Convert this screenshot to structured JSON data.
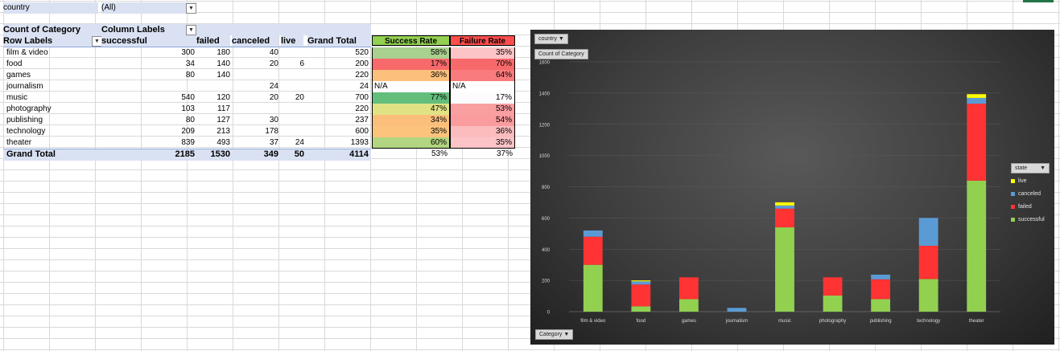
{
  "filter": {
    "label": "country",
    "value": "(All)"
  },
  "pivot": {
    "header1": {
      "measure": "Count of Category",
      "col_labels": "Column Labels"
    },
    "header2": {
      "row_labels": "Row Labels",
      "cols": [
        "successful",
        "failed",
        "canceled",
        "live",
        "Grand Total"
      ]
    },
    "rows": [
      {
        "label": "film & video",
        "successful": "300",
        "failed": "180",
        "canceled": "40",
        "live": "",
        "total": "520"
      },
      {
        "label": "food",
        "successful": "34",
        "failed": "140",
        "canceled": "20",
        "live": "6",
        "total": "200"
      },
      {
        "label": "games",
        "successful": "80",
        "failed": "140",
        "canceled": "",
        "live": "",
        "total": "220"
      },
      {
        "label": "journalism",
        "successful": "",
        "failed": "",
        "canceled": "24",
        "live": "",
        "total": "24"
      },
      {
        "label": "music",
        "successful": "540",
        "failed": "120",
        "canceled": "20",
        "live": "20",
        "total": "700"
      },
      {
        "label": "photography",
        "successful": "103",
        "failed": "117",
        "canceled": "",
        "live": "",
        "total": "220"
      },
      {
        "label": "publishing",
        "successful": "80",
        "failed": "127",
        "canceled": "30",
        "live": "",
        "total": "237"
      },
      {
        "label": "technology",
        "successful": "209",
        "failed": "213",
        "canceled": "178",
        "live": "",
        "total": "600"
      },
      {
        "label": "theater",
        "successful": "839",
        "failed": "493",
        "canceled": "37",
        "live": "24",
        "total": "1393"
      }
    ],
    "grand_total": {
      "label": "Grand Total",
      "successful": "2185",
      "failed": "1530",
      "canceled": "349",
      "live": "50",
      "total": "4114"
    }
  },
  "rates": {
    "success_header": "Success Rate",
    "failure_header": "Failure Rate",
    "success": [
      "58%",
      "17%",
      "36%",
      "N/A",
      "77%",
      "47%",
      "34%",
      "35%",
      "60%"
    ],
    "failure": [
      "35%",
      "70%",
      "64%",
      "N/A",
      "17%",
      "53%",
      "54%",
      "36%",
      "35%"
    ],
    "success_colors": [
      "#a9d08e",
      "#f8696b",
      "#fdc07c",
      "#ffffff",
      "#63be7b",
      "#e0e383",
      "#fcbf7b",
      "#fcc37c",
      "#b1d580"
    ],
    "failure_colors": [
      "#fcc4c7",
      "#f8696b",
      "#f97b7d",
      "#ffffff",
      "#fcfcff",
      "#fa9fa1",
      "#fa9b9d",
      "#fbbcbe",
      "#fcc4c7"
    ],
    "totals": {
      "success": "53%",
      "failure": "37%"
    }
  },
  "chart": {
    "filter_button": "country",
    "value_button": "Count of Category",
    "axis_button": "Category",
    "legend_title": "state",
    "colors": {
      "successful": "#92d050",
      "failed": "#ff3333",
      "canceled": "#5b9bd5",
      "live": "#ffff00"
    }
  },
  "chart_data": {
    "type": "bar",
    "stacked": true,
    "categories": [
      "film & video",
      "food",
      "games",
      "journalism",
      "music",
      "photography",
      "publishing",
      "technology",
      "theater"
    ],
    "series": [
      {
        "name": "successful",
        "values": [
          300,
          34,
          80,
          0,
          540,
          103,
          80,
          209,
          839
        ]
      },
      {
        "name": "failed",
        "values": [
          180,
          140,
          140,
          0,
          120,
          117,
          127,
          213,
          493
        ]
      },
      {
        "name": "canceled",
        "values": [
          40,
          20,
          0,
          24,
          20,
          0,
          30,
          178,
          37
        ]
      },
      {
        "name": "live",
        "values": [
          0,
          6,
          0,
          0,
          20,
          0,
          0,
          0,
          24
        ]
      }
    ],
    "legend_order": [
      "live",
      "canceled",
      "failed",
      "successful"
    ],
    "yticks": [
      "0",
      "200",
      "400",
      "600",
      "800",
      "1000",
      "1200",
      "1400",
      "1600"
    ],
    "ylim": [
      0,
      1600
    ],
    "grid": true,
    "legend_position": "right"
  }
}
